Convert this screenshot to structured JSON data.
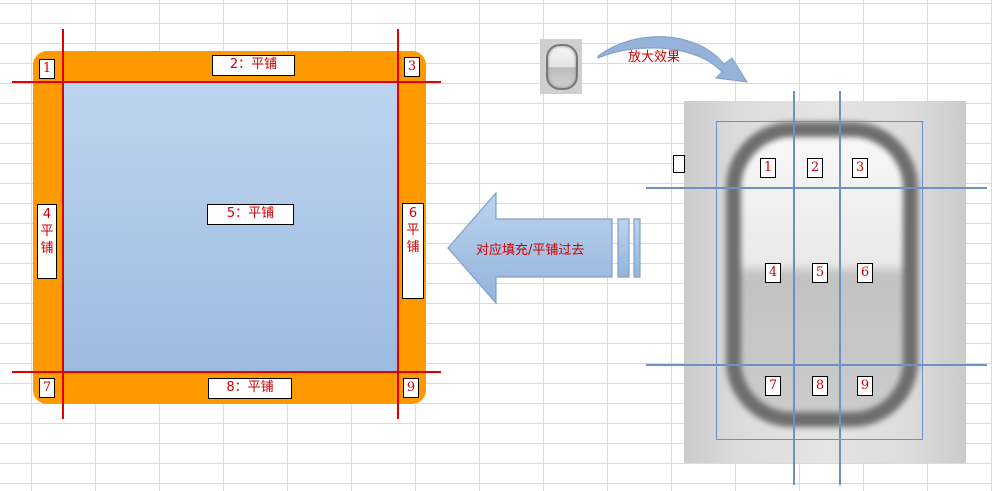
{
  "left_diagram": {
    "corner_labels": [
      "1",
      "3",
      "7",
      "9"
    ],
    "top_label": "2：平铺",
    "center_label": "5：平铺",
    "bottom_label": "8：平铺",
    "left_label_num": "4",
    "left_label_text": "平铺",
    "right_label_num": "6",
    "right_label_text": "平铺"
  },
  "arrows": {
    "fill_arrow_text": "对应填充/平铺过去",
    "zoom_arrow_text": "放大效果"
  },
  "right_diagram": {
    "cells": [
      "1",
      "2",
      "3",
      "4",
      "5",
      "6",
      "7",
      "8",
      "9"
    ]
  },
  "colors": {
    "frame_orange": "#ff9900",
    "split_line_red": "#e00000",
    "split_line_blue": "#6a92c4",
    "center_blue_top": "#bdd4ee",
    "center_blue_bottom": "#9dbbe0",
    "label_text_red": "#cc0000",
    "arrow_blue": "#a9c6e6"
  }
}
